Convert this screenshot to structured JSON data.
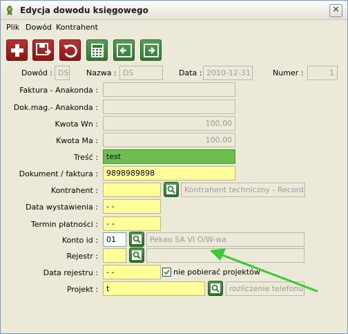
{
  "window": {
    "title": "Edycja dowodu księgowego",
    "close_glyph": "✕"
  },
  "menu": {
    "items": [
      "Plik",
      "Dowód",
      "Kontrahent"
    ]
  },
  "toolbar": {
    "icons": [
      "add-icon",
      "save-icon",
      "undo-icon",
      "calculator-icon",
      "prev-icon",
      "next-icon"
    ]
  },
  "header": {
    "dowod_label": "Dowód :",
    "dowod_value": "DS",
    "nazwa_label": "Nazwa :",
    "nazwa_value": "DS",
    "data_label": "Data :",
    "data_value": "2010-12-31",
    "numer_label": "Numer :",
    "numer_value": "1"
  },
  "form": {
    "faktura_label": "Faktura - Anakonda :",
    "faktura_value": "",
    "dokmag_label": "Dok.mag.- Anakonda :",
    "dokmag_value": "",
    "kwota_wn_label": "Kwota Wn :",
    "kwota_wn_value": "100,00",
    "kwota_ma_label": "Kwota Ma :",
    "kwota_ma_value": "100,00",
    "tresc_label": "Treść :",
    "tresc_value": "test",
    "dokument_label": "Dokument / faktura :",
    "dokument_value": "9898989898",
    "kontrahent_label": "Kontrahent :",
    "kontrahent_value": "",
    "kontrahent_name": "Kontrahent techniczny - Record",
    "data_wyst_label": "Data wystawienia :",
    "data_wyst_value": "  -  -",
    "termin_label": "Termin płatności :",
    "termin_value": "  -  -",
    "konto_label": "Konto id :",
    "konto_value": "01",
    "konto_name": "Pekao SA VI O/W-wa",
    "rejestr_label": "Rejestr :",
    "rejestr_value": "",
    "rejestr_name": "",
    "data_rej_label": "Data rejestru :",
    "data_rej_value": "  -  -",
    "nie_pobierac_label": "nie pobierać projektów",
    "nie_pobierac_checked": true,
    "projekt_label": "Projekt :",
    "projekt_value": "t",
    "projekt_name": "rozliczenie telefonu"
  },
  "colors": {
    "required_field": "#ffff99",
    "active_field": "#6cbf4d",
    "annotation_arrow": "#33cc33"
  }
}
